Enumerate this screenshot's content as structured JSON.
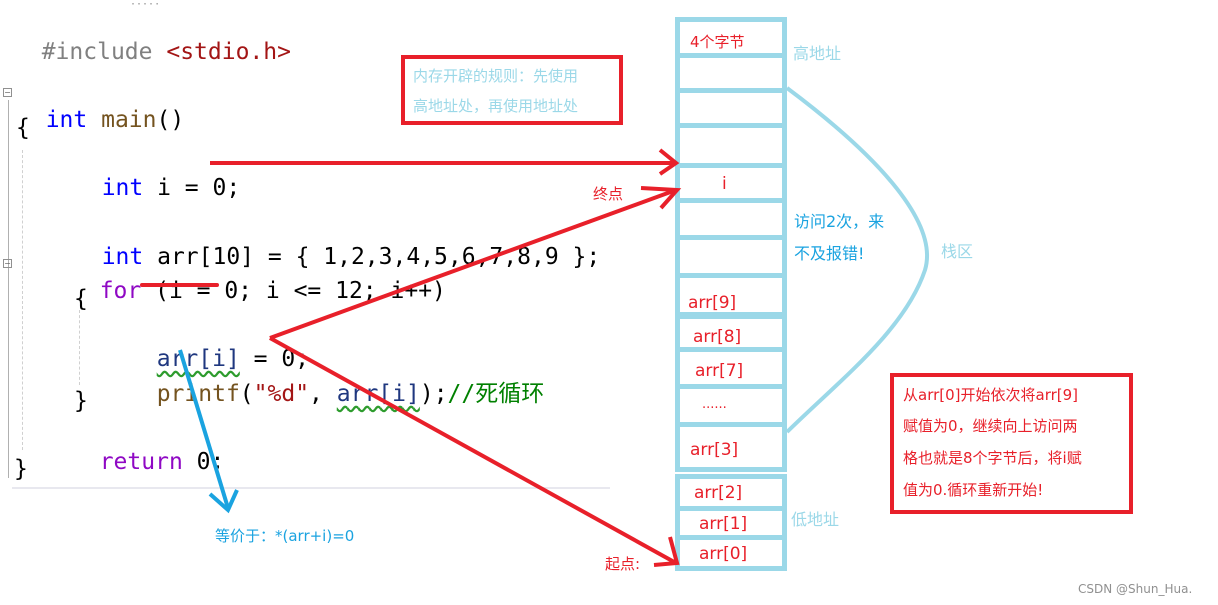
{
  "code": {
    "dots": "·····",
    "include_directive": "#include",
    "include_header": "<stdio.h>",
    "main_type": "int",
    "main_name": "main",
    "main_parens": "()",
    "open_brace": "{",
    "decl_i_type": "int",
    "decl_i_rest": " i = 0;",
    "decl_arr_type": "int",
    "decl_arr_rest": " arr[10] = { 1,2,3,4,5,6,7,8,9 };",
    "for_kw": "for",
    "for_rest": " (i = 0; i <= 12; i++)",
    "for_open": "{",
    "assign_arr": "arr[i]",
    "assign_rest": " = 0;",
    "printf_fn": "printf",
    "printf_open": "(",
    "printf_fmt": "\"%d\"",
    "printf_comma": ", ",
    "printf_arg": "arr[i]",
    "printf_close": ");",
    "comment": "//死循环",
    "for_close": "}",
    "return_kw": "return",
    "return_rest": " 0;",
    "close_brace": "}"
  },
  "annotations": {
    "memory_rule_line1": "内存开辟的规则：先使用",
    "memory_rule_line2": "高地址处，再使用地址处",
    "end_point": "终点",
    "start_point": "起点:",
    "equivalent": "等价于：*(arr+i)=0",
    "visit_twice_line1": "访问2次，来",
    "visit_twice_line2": "不及报错!",
    "stack_area": "栈区",
    "high_address": "高地址",
    "low_address": "低地址",
    "explain_line1": "从arr[0]开始依次将arr[9]",
    "explain_line2": "赋值为0，继续向上访问两",
    "explain_line3": "格也就是8个字节后，将i赋",
    "explain_line4": "值为0.循环重新开始!"
  },
  "stack": {
    "cells": [
      {
        "label": "4个字节"
      },
      {
        "label": ""
      },
      {
        "label": ""
      },
      {
        "label": ""
      },
      {
        "label": "i"
      },
      {
        "label": ""
      },
      {
        "label": ""
      },
      {
        "label": "arr[9]"
      },
      {
        "label": "arr[8]"
      },
      {
        "label": "arr[7]"
      },
      {
        "label": "......"
      },
      {
        "label": "arr[3]"
      },
      {
        "label": "arr[2]"
      },
      {
        "label": "arr[1]"
      },
      {
        "label": "arr[0]"
      }
    ]
  },
  "colors": {
    "red": "#e8202a",
    "light_blue": "#9bd8e8",
    "blue": "#1aa3e0"
  },
  "watermark": "CSDN @Shun_Hua."
}
